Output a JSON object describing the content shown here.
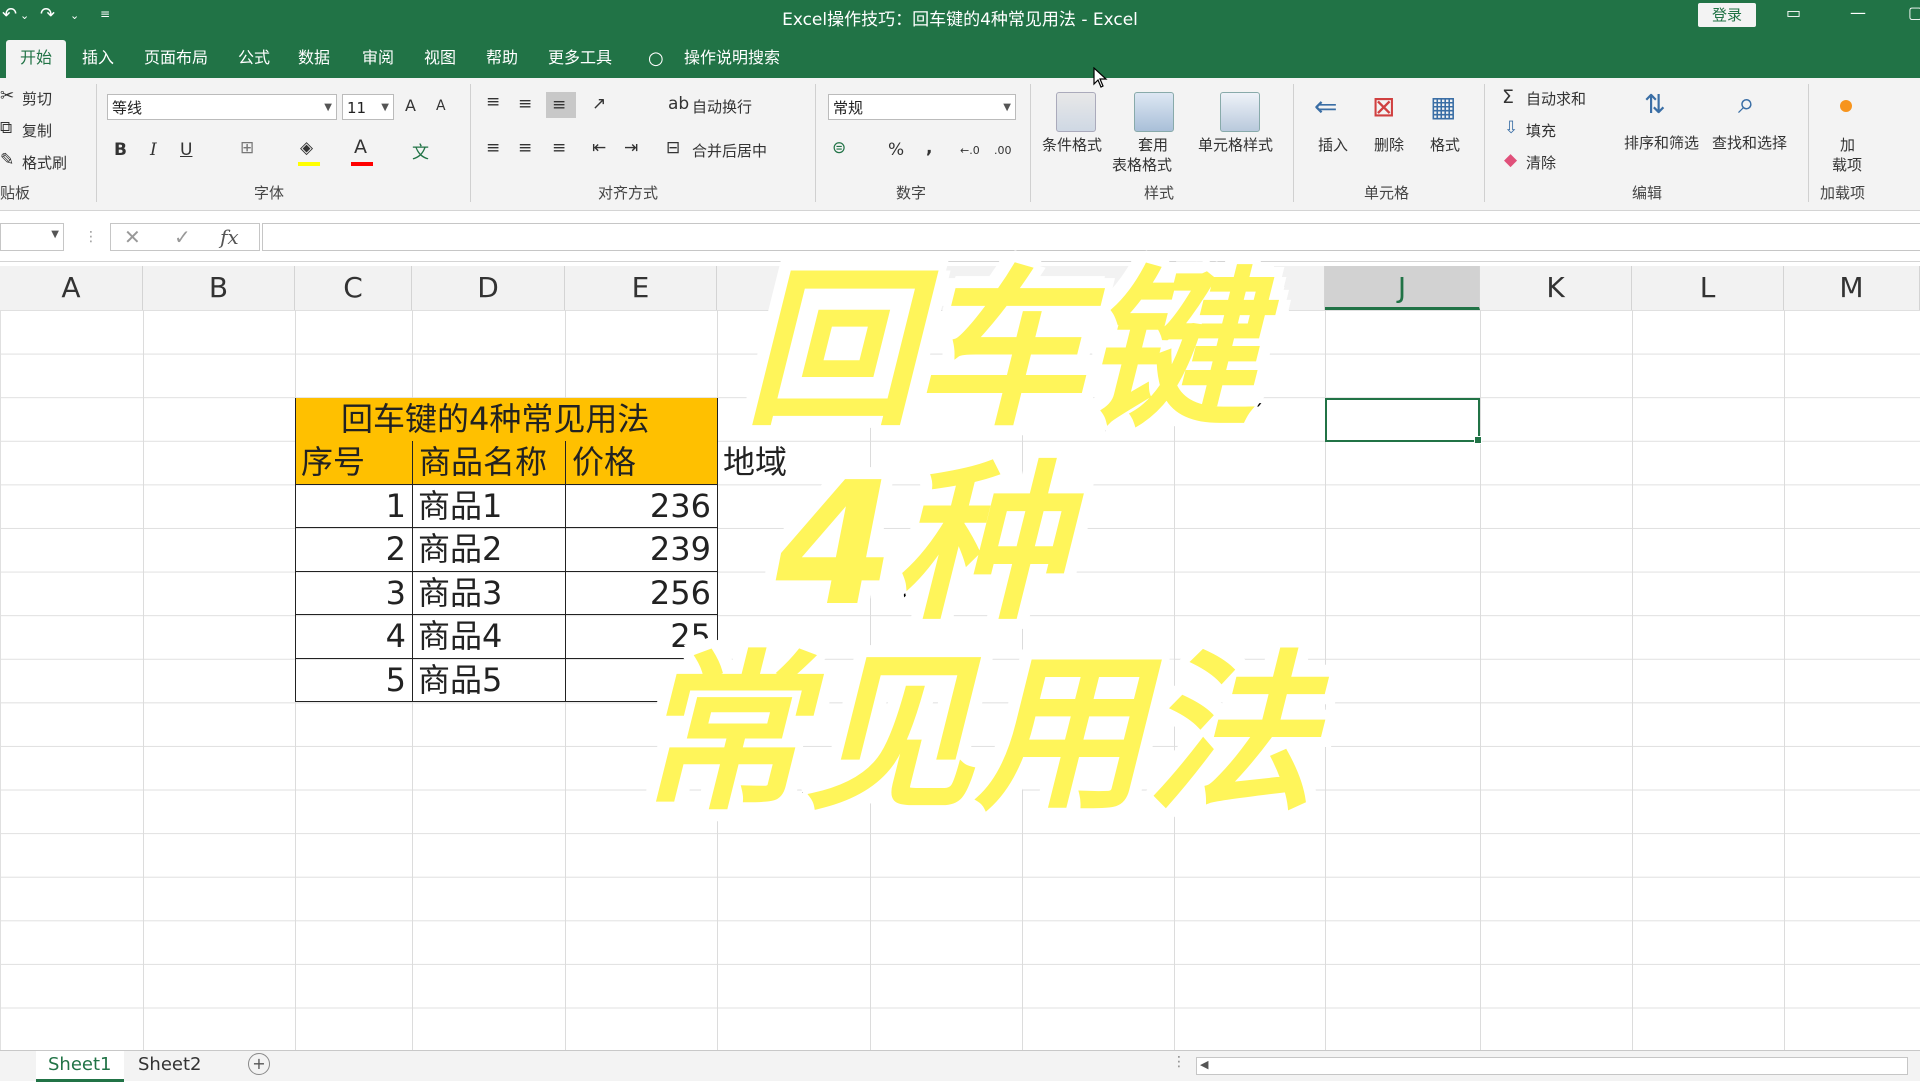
{
  "titlebar": {
    "title": "Excel操作技巧：回车键的4种常见用法  -  Excel",
    "login": "登录",
    "undo_icon": "undo-icon",
    "redo_icon": "redo-icon"
  },
  "tabs": [
    "开始",
    "插入",
    "页面布局",
    "公式",
    "数据",
    "审阅",
    "视图",
    "帮助",
    "更多工具"
  ],
  "tellme": "操作说明搜索",
  "ribbon": {
    "clipboard": {
      "cut": "剪切",
      "copy": "复制",
      "format_painter": "格式刷",
      "group": "贴板"
    },
    "font": {
      "name": "等线",
      "size": "11",
      "group": "字体",
      "bold": "B",
      "italic": "I",
      "underline": "U",
      "grow": "A",
      "shrink": "A",
      "font_color": "A"
    },
    "alignment": {
      "wrap": "自动换行",
      "merge": "合并后居中",
      "group": "对齐方式"
    },
    "number": {
      "format": "常规",
      "percent": "%",
      "comma": ",",
      "inc": "←.0",
      "dec": ".00",
      "group": "数字"
    },
    "styles": {
      "conditional": "条件格式",
      "table1": "套用",
      "table2": "表格格式",
      "cell_styles": "单元格样式",
      "group": "样式"
    },
    "cells": {
      "insert": "插入",
      "delete": "删除",
      "format": "格式",
      "group": "单元格"
    },
    "editing": {
      "autosum": "自动求和",
      "fill": "填充",
      "clear": "清除",
      "sort1": "排序和筛选",
      "find": "查找和选择",
      "group": "编辑"
    },
    "addins": {
      "label1": "加",
      "label2": "载项",
      "group": "加载项"
    }
  },
  "formula_bar": {
    "fx": "fx",
    "cancel": "✕",
    "enter": "✓"
  },
  "columns": [
    "A",
    "B",
    "C",
    "D",
    "E",
    "J",
    "K",
    "L",
    "M"
  ],
  "sheet": {
    "table_title": "回车键的4种常见用法",
    "headers": [
      "序号",
      "商品名称",
      "价格"
    ],
    "extra_header": "地域",
    "rows": [
      {
        "no": "1",
        "name": "商品1",
        "price": "236"
      },
      {
        "no": "2",
        "name": "商品2",
        "price": "239"
      },
      {
        "no": "3",
        "name": "商品3",
        "price": "256"
      },
      {
        "no": "4",
        "name": "商品4",
        "price": "25"
      },
      {
        "no": "5",
        "name": "商品5",
        "price": ""
      }
    ]
  },
  "overlay": {
    "line1": "回车键",
    "line2": "4种",
    "line3": "常见用法"
  },
  "sheet_tabs": [
    "Sheet1",
    "Sheet2"
  ],
  "colors": {
    "excel_green": "#217346",
    "header_fill": "#ffc000",
    "overlay_text": "#fff55a"
  }
}
